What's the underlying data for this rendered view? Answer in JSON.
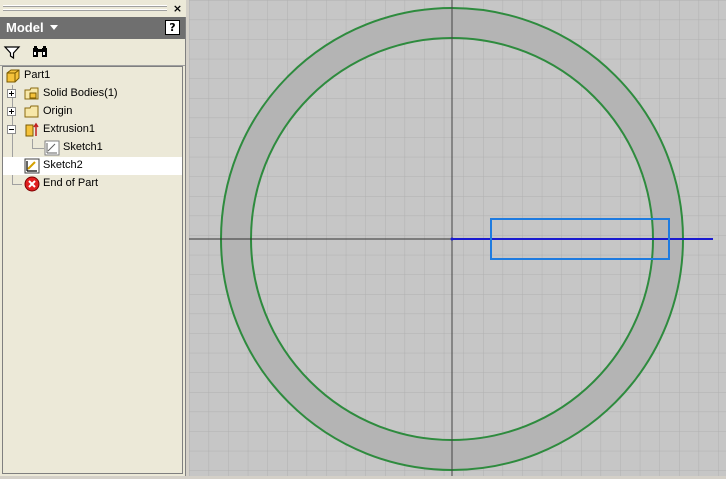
{
  "browser": {
    "title": "Model",
    "help": "?",
    "close": "×",
    "toolbar": [
      {
        "icon": "filter-icon"
      },
      {
        "icon": "binoculars-icon"
      }
    ],
    "tree": [
      {
        "label": "Part1",
        "icon": "part-icon",
        "level": 0
      },
      {
        "label": "Solid Bodies(1)",
        "icon": "solid-bodies-icon",
        "level": 1,
        "expander": "plus"
      },
      {
        "label": "Origin",
        "icon": "folder-icon",
        "level": 1,
        "expander": "plus"
      },
      {
        "label": "Extrusion1",
        "icon": "extrusion-icon",
        "level": 1,
        "expander": "minus"
      },
      {
        "label": "Sketch1",
        "icon": "sketch-icon",
        "level": 2
      },
      {
        "label": "Sketch2",
        "icon": "sketch-active-icon",
        "level": 1,
        "selected": true
      },
      {
        "label": "End of Part",
        "icon": "end-of-part-icon",
        "level": 1
      }
    ]
  },
  "canvas": {
    "background": "#c6c6c6",
    "grid_color": "#b0b0b0",
    "ring_fill": "#b4b4b4",
    "circle_color": "#2e8b3e",
    "axis_color": "#333333",
    "sketch_line_color": "#1a1ad0",
    "rectangle_color": "#1e7be0"
  }
}
